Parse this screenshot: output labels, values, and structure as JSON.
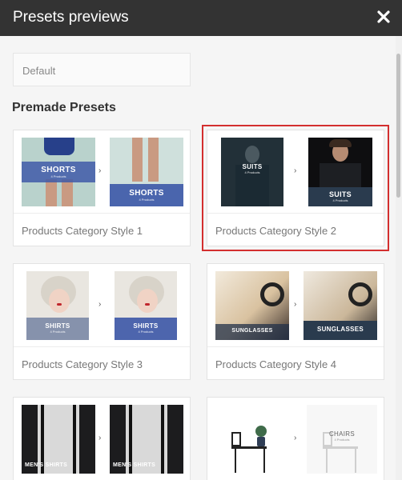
{
  "dialog": {
    "title": "Presets previews",
    "close_icon": "close-icon"
  },
  "default_preset": {
    "label": "Default"
  },
  "section": {
    "title": "Premade Presets"
  },
  "presets": [
    {
      "label": "Products Category Style 1",
      "before": "SHORTS",
      "after": "SHORTS",
      "sub": "4 Products",
      "selected": false
    },
    {
      "label": "Products Category Style 2",
      "before": "SUITS",
      "after": "SUITS",
      "sub": "4 Products",
      "selected": true
    },
    {
      "label": "Products Category Style 3",
      "before": "SHIRTS",
      "after": "SHIRTS",
      "sub": "4 Products",
      "selected": false
    },
    {
      "label": "Products Category Style 4",
      "before": "SUNGLASSES",
      "after": "SUNGLASSES",
      "sub": "4 Products",
      "selected": false
    },
    {
      "label": "",
      "before": "MEN'S SHIRTS",
      "after": "MEN'S SHIRTS",
      "sub": "4 Products",
      "selected": false
    },
    {
      "label": "",
      "before": "",
      "after": "CHAIRS",
      "sub": "4 Products",
      "selected": false
    }
  ],
  "colors": {
    "titlebar": "#333333",
    "selected_outline": "#d32f2f",
    "band_blue": "#3f5aa8",
    "band_navy": "#223048"
  }
}
